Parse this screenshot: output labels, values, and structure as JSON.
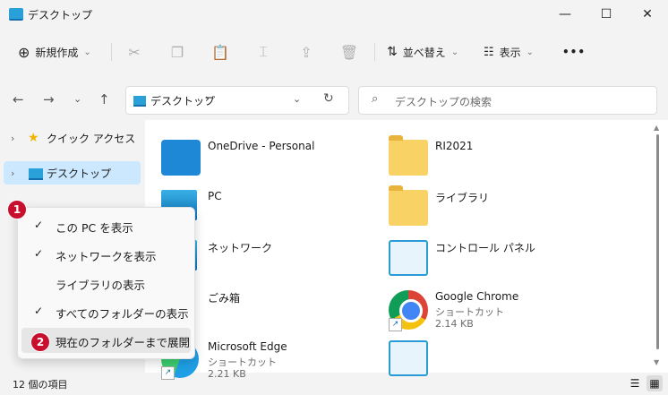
{
  "window": {
    "title": "デスクトップ",
    "minimize": "—",
    "maximize": "☐",
    "close": "✕"
  },
  "toolbar": {
    "new_label": "新規作成",
    "new_icon": "⊕",
    "sort_label": "並べ替え",
    "view_label": "表示",
    "more": "•••",
    "chevron": "⌄"
  },
  "nav": {
    "back": "←",
    "forward": "→",
    "recent": "⌄",
    "up": "↑",
    "address": "デスクトップ",
    "address_sep": "›",
    "address_dd": "⌄",
    "refresh": "↻"
  },
  "search": {
    "placeholder": "デスクトップの検索",
    "icon": "⌕"
  },
  "sidebar": {
    "items": [
      {
        "label": "クイック アクセス",
        "icon": "star-icon",
        "chevron": "›"
      },
      {
        "label": "デスクトップ",
        "icon": "desktop-folder-icon",
        "chevron": "›"
      }
    ]
  },
  "files": [
    {
      "name": "OneDrive - Personal",
      "icon": "onedrive-folder-icon"
    },
    {
      "name": "RI2021",
      "icon": "folder-icon"
    },
    {
      "name": "PC",
      "icon": "pc-icon"
    },
    {
      "name": "ライブラリ",
      "icon": "library-icon"
    },
    {
      "name": "ネットワーク",
      "icon": "network-icon"
    },
    {
      "name": "コントロール パネル",
      "icon": "control-panel-icon"
    },
    {
      "name": "ごみ箱",
      "icon": "recycle-bin-icon"
    },
    {
      "name": "Google Chrome",
      "type": "ショートカット",
      "size": "2.14 KB",
      "icon": "chrome-icon"
    },
    {
      "name": "Microsoft Edge",
      "type": "ショートカット",
      "size": "2.21 KB",
      "icon": "edge-icon"
    },
    {
      "name": "",
      "icon": "control-panel-icon"
    }
  ],
  "context_menu": {
    "items": [
      {
        "label": "この PC を表示",
        "check": "✓"
      },
      {
        "label": "ネットワークを表示",
        "check": "✓"
      },
      {
        "label": "ライブラリの表示",
        "check": ""
      },
      {
        "label": "すべてのフォルダーの表示",
        "check": "✓"
      },
      {
        "label": "現在のフォルダーまで展開",
        "check": ""
      }
    ]
  },
  "badges": {
    "one": "1",
    "two": "2"
  },
  "status": {
    "count": "12 個の項目",
    "details_view": "☰",
    "tiles_view": "▦"
  },
  "colors": {
    "selection": "#cce8ff",
    "accent": "#1670b0",
    "badge": "#c8102e"
  }
}
